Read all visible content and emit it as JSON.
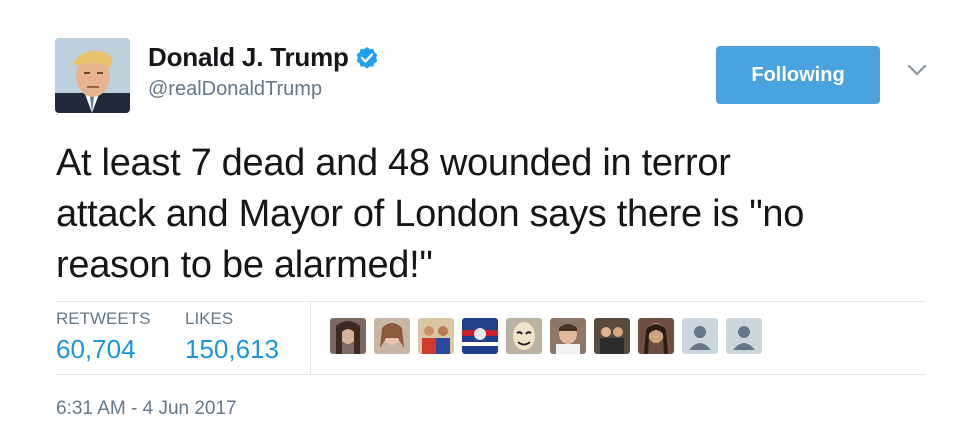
{
  "user": {
    "display_name": "Donald J. Trump",
    "handle": "@realDonaldTrump",
    "verified_icon": "verified-badge-icon"
  },
  "follow_button": {
    "label": "Following"
  },
  "tweet": {
    "lines": [
      "At least 7 dead and 48 wounded in terror",
      "attack and Mayor of London says there is \"no",
      "reason to be alarmed!\""
    ]
  },
  "stats": {
    "retweets_label": "RETWEETS",
    "retweets_count": "60,704",
    "likes_label": "LIKES",
    "likes_count": "150,613"
  },
  "timestamp": "6:31 AM - 4 Jun 2017",
  "colors": {
    "accent": "#1b95e0",
    "button": "#4aa3df",
    "muted": "#657786",
    "divider": "#e1e8ed"
  }
}
